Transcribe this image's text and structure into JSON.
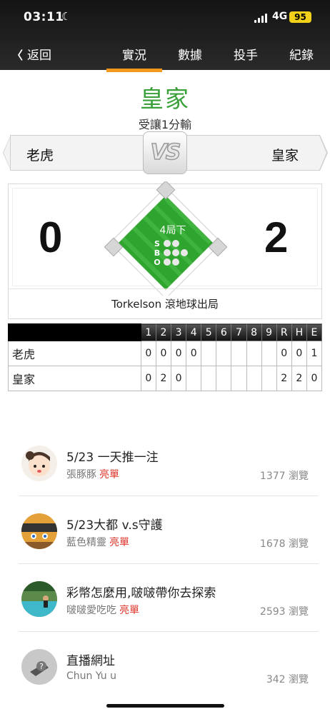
{
  "status_bar": {
    "time": "03:11",
    "network": "4G",
    "battery": "95"
  },
  "nav": {
    "back_label": "返回",
    "tabs": [
      {
        "label": "實況",
        "active": true
      },
      {
        "label": "數據",
        "active": false
      },
      {
        "label": "投手",
        "active": false
      },
      {
        "label": "紀錄",
        "active": false
      }
    ]
  },
  "result": {
    "winner": "皇家",
    "subtitle": "受讓1分輸"
  },
  "matchup": {
    "away": "老虎",
    "home": "皇家",
    "vs": "VS",
    "away_score": "0",
    "home_score": "2",
    "inning": "4局下",
    "count_labels": {
      "s": "S",
      "b": "B",
      "o": "O"
    },
    "last_play": "Torkelson 滾地球出局"
  },
  "colors": {
    "accent": "#f39a1e",
    "winner": "#3aa13a",
    "tag": "#e0352a",
    "field": "#2fa52f"
  },
  "linescore": {
    "headers": [
      "1",
      "2",
      "3",
      "4",
      "5",
      "6",
      "7",
      "8",
      "9",
      "R",
      "H",
      "E"
    ],
    "rows": [
      {
        "team": "老虎",
        "cells": [
          "0",
          "0",
          "0",
          "0",
          "",
          "",
          "",
          "",
          "",
          "0",
          "0",
          "1"
        ]
      },
      {
        "team": "皇家",
        "cells": [
          "0",
          "2",
          "0",
          "",
          "",
          "",
          "",
          "",
          "",
          "2",
          "2",
          "0"
        ]
      }
    ]
  },
  "articles": [
    {
      "title": "5/23 一天推一注",
      "author": "張豚豚",
      "tag": "亮單",
      "views": "1377 瀏覽",
      "avatar": "cartoon-girl-avatar"
    },
    {
      "title": "5/23大都 v.s守護",
      "author": "藍色精靈",
      "tag": "亮單",
      "views": "1678 瀏覽",
      "avatar": "ninja-avatar"
    },
    {
      "title": "彩幣怎麼用,啵啵帶你去探索",
      "author": "啵啵愛吃吃",
      "tag": "亮單",
      "views": "2593 瀏覽",
      "avatar": "pool-avatar"
    },
    {
      "title": "直播網址",
      "author": "Chun Yu u",
      "tag": "",
      "views": "342 瀏覽",
      "avatar": "default-avatar"
    }
  ]
}
